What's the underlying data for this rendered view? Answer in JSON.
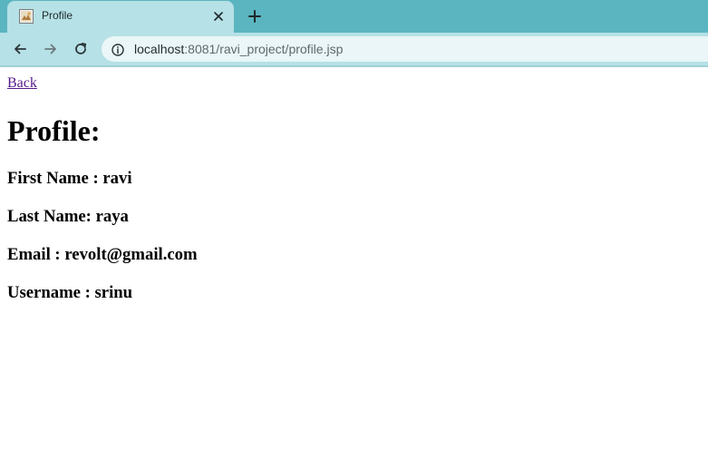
{
  "browser": {
    "tab": {
      "title": "Profile",
      "favicon": "page-favicon-icon"
    },
    "newtab_icon": "plus-icon",
    "close_icon": "close-icon",
    "nav": {
      "back_icon": "arrow-left-icon",
      "forward_icon": "arrow-right-icon",
      "reload_icon": "reload-icon"
    },
    "address": {
      "info_icon": "info-icon",
      "host": "localhost",
      "rest": ":8081/ravi_project/profile.jsp"
    },
    "colors": {
      "tabstrip": "#5ab5c0",
      "toolbar": "#b6e1e6",
      "omnibox": "#eaf6f7",
      "visited_link": "#551a8b"
    }
  },
  "page": {
    "back_link": "Back",
    "heading": "Profile:",
    "fields": {
      "first_name": "First Name : ravi",
      "last_name": "Last Name: raya",
      "email": "Email : revolt@gmail.com",
      "username": "Username : srinu"
    }
  }
}
